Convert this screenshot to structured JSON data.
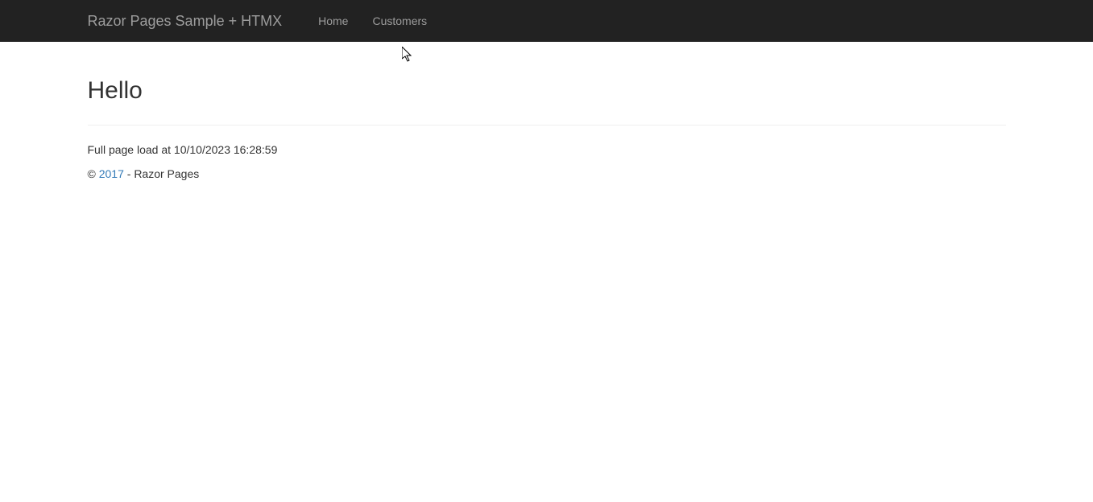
{
  "navbar": {
    "brand": "Razor Pages Sample + HTMX",
    "links": [
      {
        "label": "Home"
      },
      {
        "label": "Customers"
      }
    ]
  },
  "main": {
    "heading": "Hello",
    "load_info": "Full page load at 10/10/2023 16:28:59"
  },
  "footer": {
    "copyright_prefix": "© ",
    "year": "2017",
    "suffix": " - Razor Pages"
  }
}
